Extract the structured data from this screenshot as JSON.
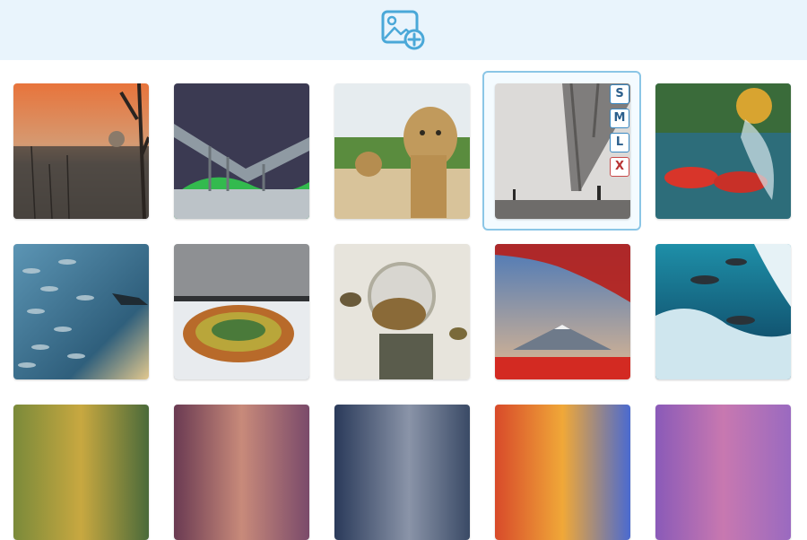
{
  "header": {
    "add_image_icon": "image-add-icon",
    "accent_color": "#4aa8d8"
  },
  "size_menu": {
    "small": "S",
    "medium": "M",
    "large": "L",
    "close": "X"
  },
  "gallery": {
    "tiles": [
      {
        "icon": "image-wildfire-koala"
      },
      {
        "icon": "image-aurora-bridge"
      },
      {
        "icon": "image-leopards"
      },
      {
        "icon": "image-foggy-bridge"
      },
      {
        "icon": "image-salmon-underwater"
      },
      {
        "icon": "image-diver-fish-school"
      },
      {
        "icon": "image-hot-spring"
      },
      {
        "icon": "image-bird-astronaut"
      },
      {
        "icon": "image-mount-fuji-maple"
      },
      {
        "icon": "image-seals-iceberg"
      },
      {
        "icon": "image-green-sunset"
      },
      {
        "icon": "image-purple-sky"
      },
      {
        "icon": "image-milky-way"
      },
      {
        "icon": "image-orange-clouds"
      },
      {
        "icon": "image-violet-clouds"
      }
    ]
  }
}
